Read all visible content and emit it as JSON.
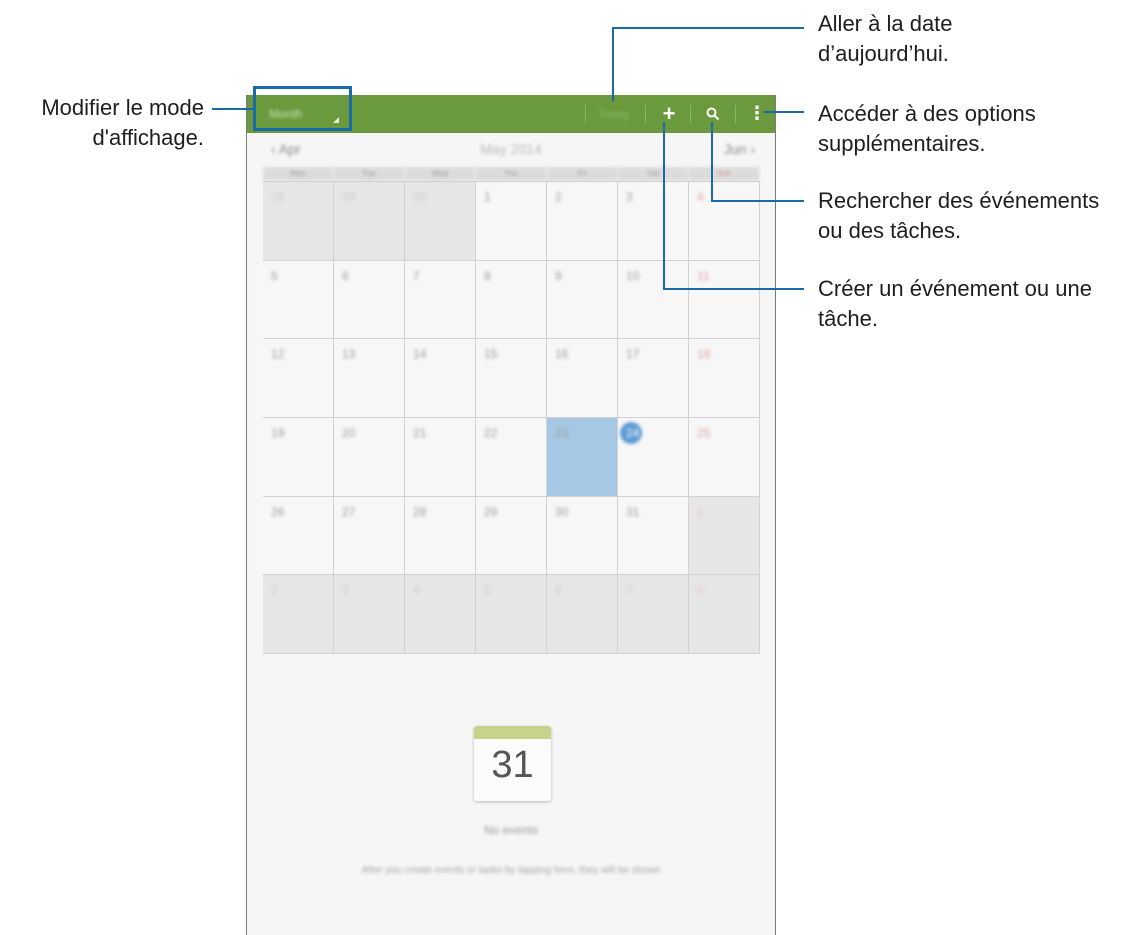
{
  "actionbar": {
    "view_mode": "Month",
    "today_label": "Today",
    "plus_icon": "+",
    "more_icon": "⋮"
  },
  "month_nav": {
    "prev": "‹ Apr",
    "title": "May 2014",
    "next": "Jun ›"
  },
  "weekdays": [
    "Mon",
    "Tue",
    "Wed",
    "Thu",
    "Fri",
    "Sat",
    "Sun"
  ],
  "weeks": [
    [
      "28",
      "29",
      "30",
      "1",
      "2",
      "3",
      "4"
    ],
    [
      "5",
      "6",
      "7",
      "8",
      "9",
      "10",
      "11"
    ],
    [
      "12",
      "13",
      "14",
      "15",
      "16",
      "17",
      "18"
    ],
    [
      "19",
      "20",
      "21",
      "22",
      "23",
      "24",
      "25"
    ],
    [
      "26",
      "27",
      "28",
      "29",
      "30",
      "31",
      "1"
    ],
    [
      "2",
      "3",
      "4",
      "5",
      "6",
      "7",
      "8"
    ]
  ],
  "selected_date": "23",
  "today_date": "24",
  "empty_state": {
    "calendar_number": "31",
    "no_events": "No events",
    "hint": "After you create events or tasks by tapping here, they will be shown"
  },
  "callouts": {
    "view_mode": [
      "Modifier le mode",
      "d'affichage."
    ],
    "today": [
      "Aller à la date",
      "d’aujourd’hui."
    ],
    "more": [
      "Accéder à des options",
      "supplémentaires."
    ],
    "search": [
      "Rechercher des événements",
      "ou des tâches."
    ],
    "create": [
      "Créer un événement ou une",
      "tâche."
    ]
  },
  "colors": {
    "actionbar": "#6a9a3d",
    "callout_line": "#1a6aa8",
    "selected_cell": "#a7c8e4",
    "today_dot": "#5d9bd6"
  }
}
